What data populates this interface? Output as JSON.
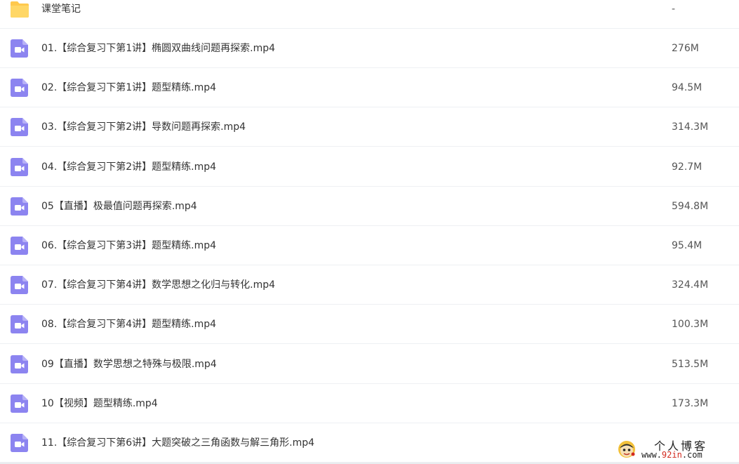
{
  "folder": {
    "name": "课堂笔记",
    "size": "-",
    "icon": "folder-icon",
    "color": "#ffc94d"
  },
  "files": [
    {
      "name": "01.【综合复习下第1讲】椭圆双曲线问题再探索.mp4",
      "size": "276M"
    },
    {
      "name": "02.【综合复习下第1讲】题型精练.mp4",
      "size": "94.5M"
    },
    {
      "name": "03.【综合复习下第2讲】导数问题再探索.mp4",
      "size": "314.3M"
    },
    {
      "name": "04.【综合复习下第2讲】题型精练.mp4",
      "size": "92.7M"
    },
    {
      "name": "05【直播】极最值问题再探索.mp4",
      "size": "594.8M"
    },
    {
      "name": "06.【综合复习下第3讲】题型精练.mp4",
      "size": "95.4M"
    },
    {
      "name": "07.【综合复习下第4讲】数学思想之化归与转化.mp4",
      "size": "324.4M"
    },
    {
      "name": "08.【综合复习下第4讲】题型精练.mp4",
      "size": "100.3M"
    },
    {
      "name": "09【直播】数学思想之特殊与极限.mp4",
      "size": "513.5M"
    },
    {
      "name": "10【视频】题型精练.mp4",
      "size": "173.3M"
    },
    {
      "name": "11.【综合复习下第6讲】大题突破之三角函数与解三角形.mp4",
      "size": ""
    }
  ],
  "file_icon": {
    "name": "video-file-icon",
    "color": "#8c84f0"
  },
  "watermark": {
    "title": "个人博客",
    "url_prefix": "www.",
    "url_accent": "92in",
    "url_suffix": ".com"
  }
}
